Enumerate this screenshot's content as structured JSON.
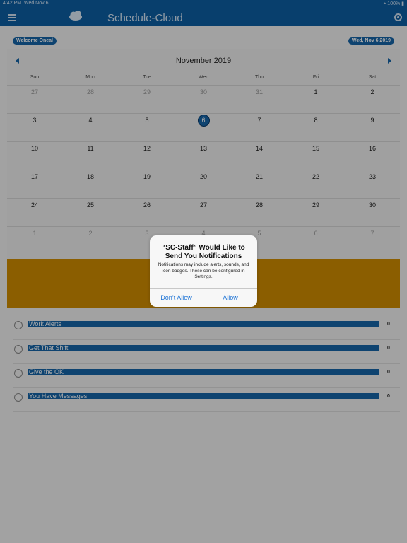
{
  "status": {
    "time": "4:42 PM",
    "date": "Wed Nov 6",
    "battery": "100%"
  },
  "nav": {
    "title": "Schedule-Cloud"
  },
  "header": {
    "welcome": "Welcome Oneal",
    "date_badge": "Wed, Nov 6 2019"
  },
  "calendar": {
    "month": "November 2019",
    "days_of_week": [
      "Sun",
      "Mon",
      "Tue",
      "Wed",
      "Thu",
      "Fri",
      "Sat"
    ],
    "weeks": [
      [
        "27",
        "28",
        "29",
        "30",
        "31",
        "1",
        "2"
      ],
      [
        "3",
        "4",
        "5",
        "6",
        "7",
        "8",
        "9"
      ],
      [
        "10",
        "11",
        "12",
        "13",
        "14",
        "15",
        "16"
      ],
      [
        "17",
        "18",
        "19",
        "20",
        "21",
        "22",
        "23"
      ],
      [
        "24",
        "25",
        "26",
        "27",
        "28",
        "29",
        "30"
      ],
      [
        "1",
        "2",
        "3",
        "4",
        "5",
        "6",
        "7"
      ]
    ],
    "selected": "6"
  },
  "alerts": [
    {
      "label": "Work Alerts",
      "count": "0",
      "icon": "clock-icon"
    },
    {
      "label": "Get That Shift",
      "count": "0",
      "icon": "timer-icon"
    },
    {
      "label": "Give the OK",
      "count": "0",
      "icon": "check-icon"
    },
    {
      "label": "You Have Messages",
      "count": "0",
      "icon": "message-icon"
    }
  ],
  "dialog": {
    "title": "“SC-Staff” Would Like to Send You Notifications",
    "message": "Notifications may include alerts, sounds, and icon badges. These can be configured in Settings.",
    "deny": "Don’t Allow",
    "allow": "Allow"
  },
  "colors": {
    "brand": "#0d5fa3",
    "event": "#d08d00",
    "link": "#1e74d6"
  }
}
